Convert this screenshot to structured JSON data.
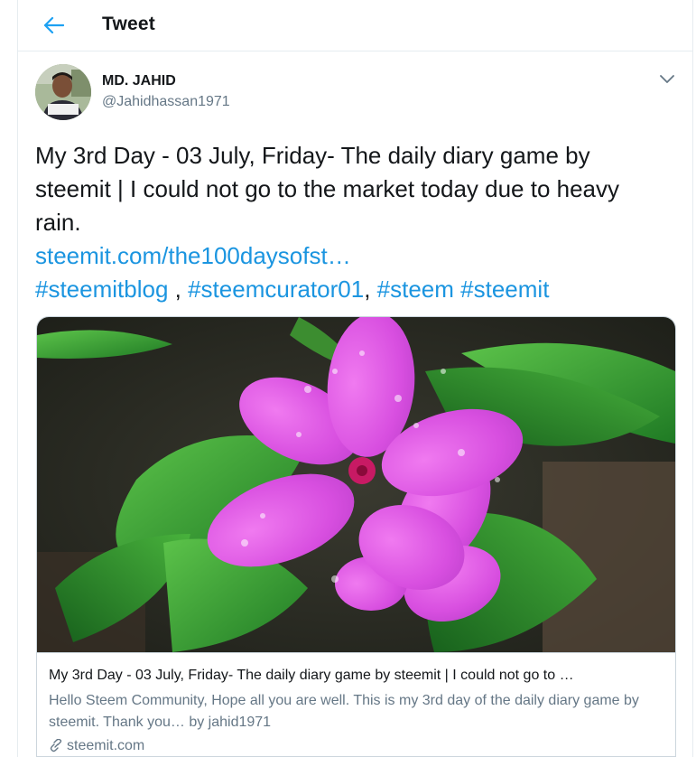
{
  "header": {
    "title": "Tweet",
    "back_icon": "arrow-left-icon",
    "accent": "#1da1f2"
  },
  "author": {
    "name": "MD. JAHID",
    "handle": "@Jahidhassan1971"
  },
  "tweet": {
    "text": "My 3rd Day - 03 July, Friday- The daily diary game by steemit | I could not go to the market today due to heavy rain.",
    "link": "steemit.com/the100daysofst…",
    "hashtags": [
      "#steemitblog",
      "#steemcurator01",
      "#steem",
      "#steemit"
    ],
    "sep1": " , ",
    "sep2": ", ",
    "sep3": " "
  },
  "card": {
    "title": "My 3rd Day - 03 July, Friday- The daily diary game by steemit | I could not go to …",
    "description": "Hello Steem Community, Hope all you are well. This is my 3rd day of the daily diary game by steemit. Thank you… by jahid1971",
    "domain": "steemit.com",
    "link_icon": "link-icon"
  },
  "colors": {
    "link": "#1b95e0",
    "text": "#14171a",
    "muted": "#657786",
    "border": "#e6ecf0"
  }
}
